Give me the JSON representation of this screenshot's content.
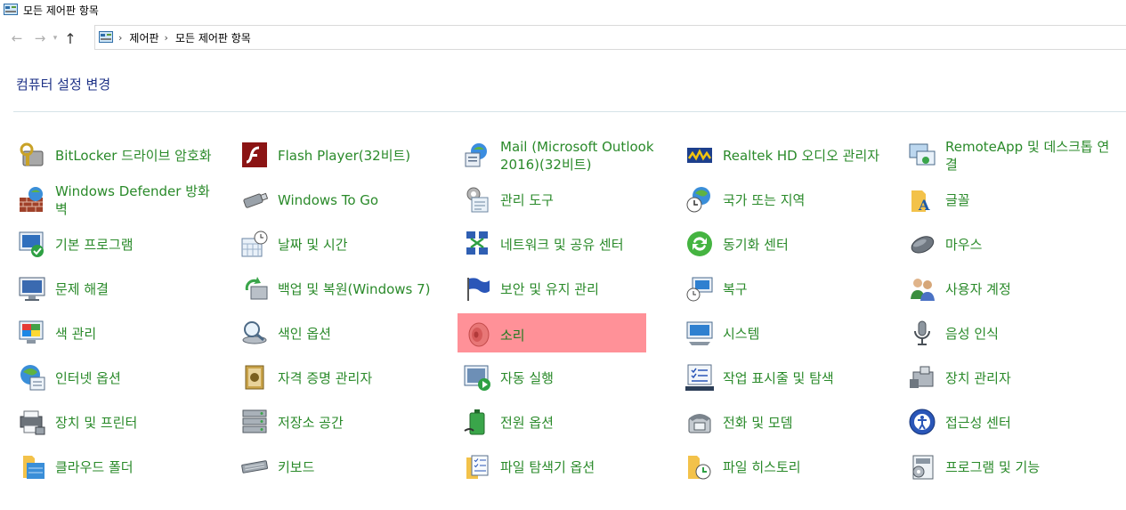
{
  "window": {
    "title": "모든 제어판 항목"
  },
  "nav": {
    "breadcrumb": [
      "제어판",
      "모든 제어판 항목"
    ]
  },
  "heading": "컴퓨터 설정 변경",
  "items": [
    {
      "label": "BitLocker 드라이브 암호화",
      "icon": "bitlocker-icon"
    },
    {
      "label": "Flash Player(32비트)",
      "icon": "flash-icon"
    },
    {
      "label": "Mail (Microsoft Outlook 2016)(32비트)",
      "icon": "mail-icon"
    },
    {
      "label": "Realtek HD 오디오 관리자",
      "icon": "realtek-icon"
    },
    {
      "label": "RemoteApp 및 데스크톱 연결",
      "icon": "remoteapp-icon"
    },
    {
      "label": "Windows Defender 방화벽",
      "icon": "firewall-icon"
    },
    {
      "label": "Windows To Go",
      "icon": "usb-drive-icon"
    },
    {
      "label": "관리 도구",
      "icon": "admin-tools-icon"
    },
    {
      "label": "국가 또는 지역",
      "icon": "region-icon"
    },
    {
      "label": "글꼴",
      "icon": "fonts-icon"
    },
    {
      "label": "기본 프로그램",
      "icon": "default-programs-icon"
    },
    {
      "label": "날짜 및 시간",
      "icon": "date-time-icon"
    },
    {
      "label": "네트워크 및 공유 센터",
      "icon": "network-icon"
    },
    {
      "label": "동기화 센터",
      "icon": "sync-icon"
    },
    {
      "label": "마우스",
      "icon": "mouse-icon"
    },
    {
      "label": "문제 해결",
      "icon": "troubleshoot-icon"
    },
    {
      "label": "백업 및 복원(Windows 7)",
      "icon": "backup-icon"
    },
    {
      "label": "보안 및 유지 관리",
      "icon": "security-flag-icon"
    },
    {
      "label": "복구",
      "icon": "recovery-icon"
    },
    {
      "label": "사용자 계정",
      "icon": "user-accounts-icon"
    },
    {
      "label": "색 관리",
      "icon": "color-management-icon"
    },
    {
      "label": "색인 옵션",
      "icon": "indexing-icon"
    },
    {
      "label": "소리",
      "icon": "speaker-icon"
    },
    {
      "label": "시스템",
      "icon": "system-icon"
    },
    {
      "label": "음성 인식",
      "icon": "microphone-icon"
    },
    {
      "label": "인터넷 옵션",
      "icon": "internet-options-icon"
    },
    {
      "label": "자격 증명 관리자",
      "icon": "credential-icon"
    },
    {
      "label": "자동 실행",
      "icon": "autoplay-icon"
    },
    {
      "label": "작업 표시줄 및 탐색",
      "icon": "taskbar-icon"
    },
    {
      "label": "장치 관리자",
      "icon": "device-manager-icon"
    },
    {
      "label": "장치 및 프린터",
      "icon": "printer-icon"
    },
    {
      "label": "저장소 공간",
      "icon": "storage-icon"
    },
    {
      "label": "전원 옵션",
      "icon": "power-icon"
    },
    {
      "label": "전화 및 모뎀",
      "icon": "phone-icon"
    },
    {
      "label": "접근성 센터",
      "icon": "accessibility-icon"
    },
    {
      "label": "클라우드 폴더",
      "icon": "cloud-folder-icon"
    },
    {
      "label": "키보드",
      "icon": "keyboard-icon"
    },
    {
      "label": "파일 탐색기 옵션",
      "icon": "explorer-options-icon"
    },
    {
      "label": "파일 히스토리",
      "icon": "file-history-icon"
    },
    {
      "label": "프로그램 및 기능",
      "icon": "programs-features-icon"
    }
  ],
  "selected_item": "소리",
  "colors": {
    "heading": "#1e3287",
    "link": "#2a8a2a",
    "selected_bg": "#ff9198"
  }
}
